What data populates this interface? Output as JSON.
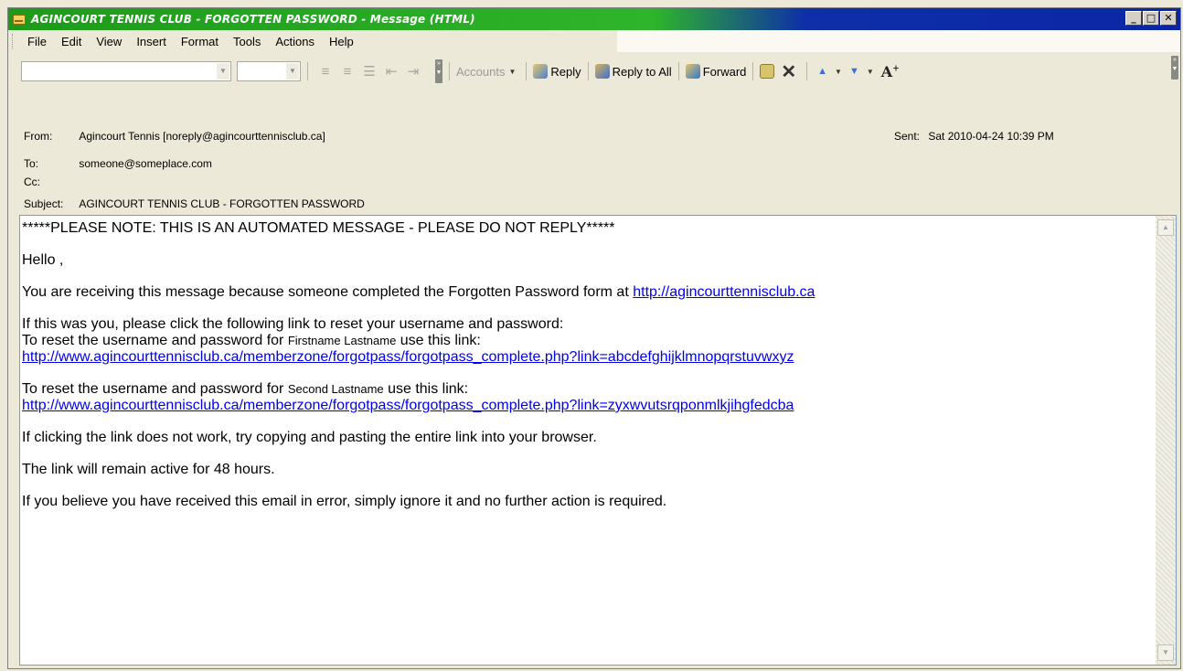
{
  "window": {
    "title": "AGINCOURT TENNIS CLUB - FORGOTTEN PASSWORD - Message (HTML)",
    "controls": {
      "minimize": "_",
      "maximize": "□",
      "close": "✕"
    }
  },
  "menu": {
    "items": [
      {
        "id": "file",
        "label": "File"
      },
      {
        "id": "edit",
        "label": "Edit"
      },
      {
        "id": "view",
        "label": "View"
      },
      {
        "id": "insert",
        "label": "Insert"
      },
      {
        "id": "format",
        "label": "Format"
      },
      {
        "id": "tools",
        "label": "Tools"
      },
      {
        "id": "actions",
        "label": "Actions"
      },
      {
        "id": "help",
        "label": "Help"
      }
    ]
  },
  "toolbar": {
    "accounts_label": "Accounts",
    "reply_label": "Reply",
    "reply_all_label": "Reply to All",
    "forward_label": "Forward"
  },
  "header": {
    "from_label": "From:",
    "from_value": "Agincourt Tennis [noreply@agincourttennisclub.ca]",
    "to_label": "To:",
    "to_value": "someone@someplace.com",
    "cc_label": "Cc:",
    "cc_value": "",
    "subject_label": "Subject:",
    "subject_value": "AGINCOURT TENNIS CLUB - FORGOTTEN PASSWORD",
    "sent_label": "Sent:",
    "sent_value": "Sat 2010-04-24 10:39 PM"
  },
  "message": {
    "notice": "*****PLEASE NOTE: THIS IS AN AUTOMATED MESSAGE - PLEASE DO NOT REPLY*****",
    "greeting": "Hello ,",
    "reason_text": "You are receiving this message because someone completed the Forgotten Password form at ",
    "reason_link": "http://agincourttennisclub.ca",
    "instruction": "If this was you, please click the following link to reset your username and password:",
    "reset_prefix": "To reset the username and password for ",
    "reset_suffix": " use this link:",
    "first_user_name": "Firstname Lastname",
    "first_link": "http://www.agincourttennisclub.ca/memberzone/forgotpass/forgotpass_complete.php?link=abcdefghijklmnopqrstuvwxyz",
    "second_user_name": "Second Lastname",
    "second_link": "http://www.agincourttennisclub.ca/memberzone/forgotpass/forgotpass_complete.php?link=zyxwvutsrqponmlkjihgfedcba",
    "copy_hint": "If clicking the link does not work, try copying and pasting the entire link into your browser.",
    "expiry": "The link will remain active for 48 hours.",
    "error_note": "If you believe you have received this email in error, simply ignore it and no further action is required."
  }
}
